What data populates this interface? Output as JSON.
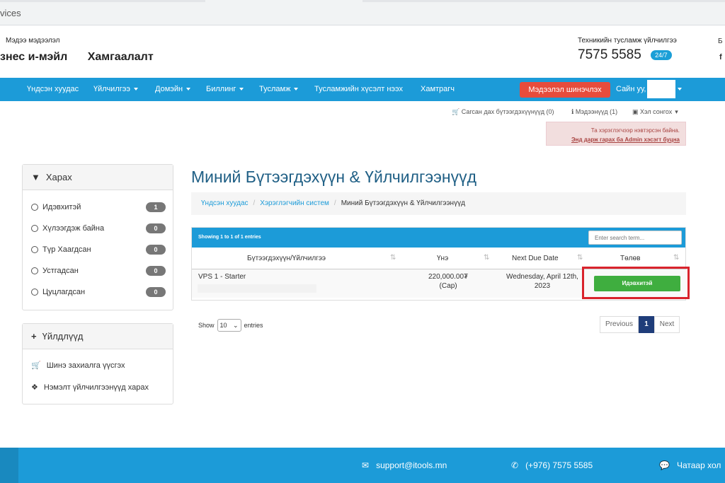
{
  "browser": {
    "url_fragment": "vices"
  },
  "header": {
    "top_label": "Мэдээ мэдээлэл",
    "brand_links": [
      "знес и-мэйл",
      "Хамгаалалт"
    ],
    "support_label": "Техникийн туслалцаа үйлчилгээ",
    "support_label_exact": "Техникийн тусламж үйлчилгээ",
    "phone": "7575 5585",
    "badge": "24/7",
    "edge_b": "Б",
    "edge_f": "f"
  },
  "nav": {
    "items": [
      "Үндсэн хуудас",
      "Үйлчилгээ",
      "Домэйн",
      "Биллинг",
      "Тусламж",
      "Тусламжийн хүсэлт нээх",
      "Хамтрагч"
    ],
    "update_button": "Мэдээлэл шинэчлэх",
    "user_label": "Сайн уу,"
  },
  "secondary": {
    "cart": "Сагсан дах бүтээгдэхүүнүүд (0)",
    "notices": "Мэдээнүүд (1)",
    "language": "Хэл сонгох"
  },
  "alert": {
    "line1": "Та хэрэглэгчээр нэвтэрсэн байна.",
    "line2": "Энд дарж гарах ба Admin хэсэгт буцна"
  },
  "filter_panel": {
    "title": "Харах",
    "items": [
      {
        "label": "Идэвхитэй",
        "count": "1"
      },
      {
        "label": "Хүлээгдэж байна",
        "count": "0"
      },
      {
        "label": "Түр Хаагдсан",
        "count": "0"
      },
      {
        "label": "Устгадсан",
        "count": "0"
      },
      {
        "label": "Цуцлагдсан",
        "count": "0"
      }
    ]
  },
  "actions_panel": {
    "title": "Үйлдлүүд",
    "items": [
      "Шинэ захиалга үүсгэх",
      "Нэмэлт үйлчилгээнүүд харах"
    ]
  },
  "main": {
    "title": "Миний Бүтээгдэхүүн & Үйлчилгээнүүд",
    "breadcrumb": [
      "Үндсэн хуудас",
      "Хэрэглэгчийн систем",
      "Миний Бүтээгдэхүүн & Үйлчилгээнүүд"
    ]
  },
  "table": {
    "info": "Showing 1 to 1 of 1 entries",
    "search_placeholder": "Enter search term...",
    "headers": [
      "Бүтээгдэхүүн/Үйлчилгээ",
      "Үнэ",
      "Next Due Date",
      "Төлөв"
    ],
    "row": {
      "product": "VPS 1 - Starter",
      "price_line1": "220,000.00₮",
      "price_line2": "(Сар)",
      "due_line1": "Wednesday, April 12th,",
      "due_line2": "2023",
      "status": "Идэвхитэй"
    }
  },
  "pagination": {
    "show_label": "Show",
    "show_value": "10",
    "entries_label": "entries",
    "previous": "Previous",
    "page": "1",
    "next": "Next"
  },
  "footer": {
    "email": "support@itools.mn",
    "phone": "(+976) 7575 5585",
    "chat": "Чатаар хол"
  }
}
